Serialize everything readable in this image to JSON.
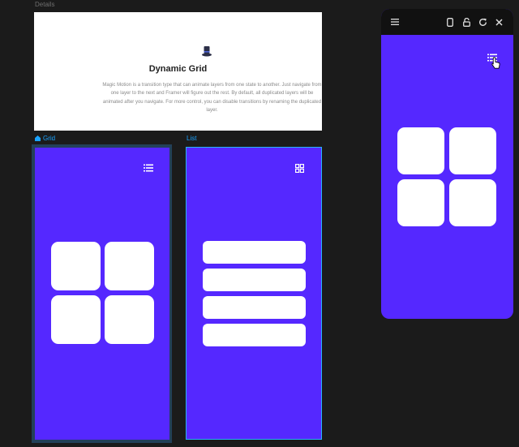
{
  "canvas": {
    "details_label": "Details",
    "grid_label": "Grid",
    "list_label": "List"
  },
  "details": {
    "title": "Dynamic Grid",
    "description": "Magic Motion is a transition type that can animate layers from one state to another. Just navigate from one layer to the next and Framer will figure out the rest. By default, all duplicated layers will be animated after you navigate. For more control, you can disable transitions by renaming the duplicated layer."
  },
  "icons": {
    "details_graphic": "top-hat-icon",
    "grid_frame_toggle": "list-icon",
    "list_frame_toggle": "grid-icon",
    "preview_menu": "hamburger-menu-icon",
    "preview_device": "phone-device-icon",
    "preview_lock": "unlock-icon",
    "preview_reload": "reload-icon",
    "preview_close": "close-icon",
    "preview_toggle": "list-icon",
    "cursor": "pointer-cursor-icon"
  },
  "colors": {
    "canvas_bg": "#1b1b1b",
    "screen_purple": "#5528ff",
    "selection_blue": "#1aa3ff",
    "tile_white": "#ffffff",
    "toolbar_bg": "#111111"
  }
}
